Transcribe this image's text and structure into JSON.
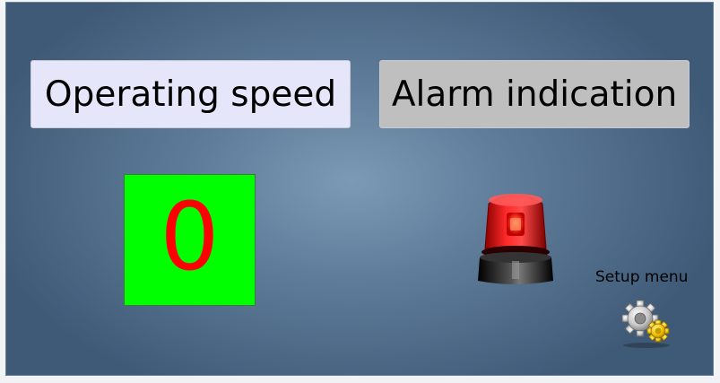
{
  "buttons": {
    "operating_speed_label": "Operating speed",
    "alarm_indication_label": "Alarm indication"
  },
  "speed": {
    "value": "0"
  },
  "setup": {
    "label": "Setup menu",
    "icon": "gear-icon"
  },
  "alarm": {
    "icon": "alarm-beacon-icon"
  },
  "colors": {
    "speed_bg": "#00ff00",
    "speed_text": "#ff0000",
    "speed_button_bg": "#e6e6fa",
    "alarm_button_bg": "#bfbfbf",
    "beacon": "#e00000"
  }
}
